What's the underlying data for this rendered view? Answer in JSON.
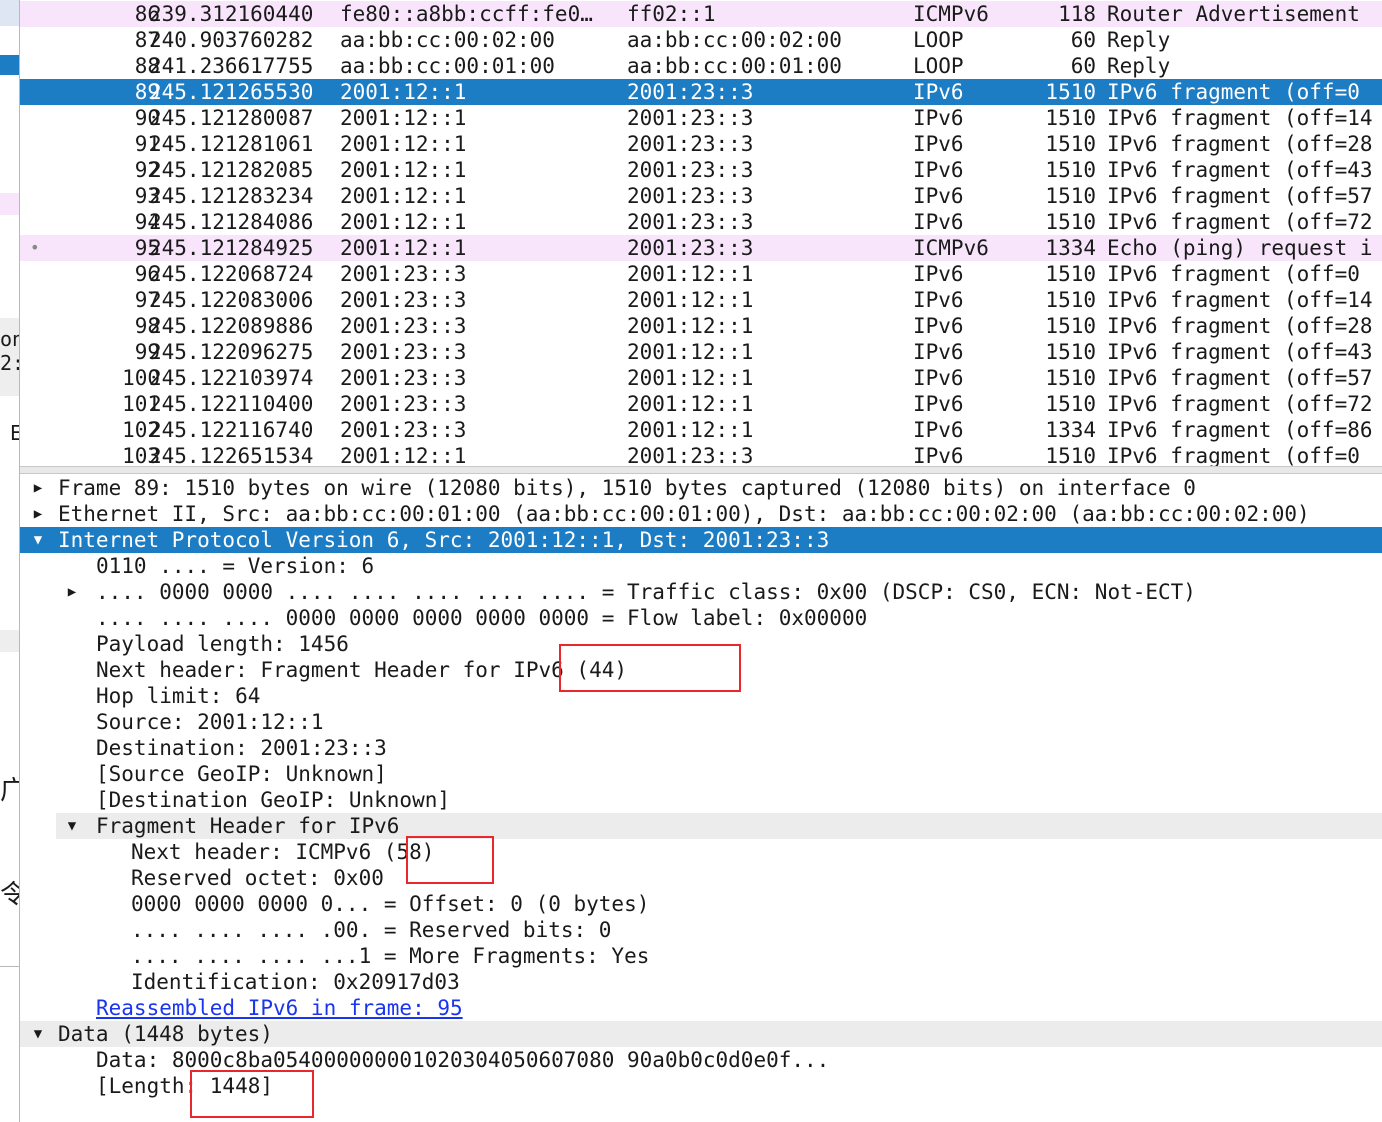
{
  "left_strip": {
    "fragments": [
      "on",
      "2:",
      "E",
      "广",
      "令"
    ]
  },
  "packets": [
    {
      "no": "86",
      "time": "239.312160440",
      "src": "fe80::a8bb:ccff:fe0…",
      "dst": "ff02::1",
      "proto": "ICMPv6",
      "len": "118",
      "info": "Router Advertisement",
      "style": "pink"
    },
    {
      "no": "87",
      "time": "240.903760282",
      "src": "aa:bb:cc:00:02:00",
      "dst": "aa:bb:cc:00:02:00",
      "proto": "LOOP",
      "len": "60",
      "info": "Reply",
      "style": ""
    },
    {
      "no": "88",
      "time": "241.236617755",
      "src": "aa:bb:cc:00:01:00",
      "dst": "aa:bb:cc:00:01:00",
      "proto": "LOOP",
      "len": "60",
      "info": "Reply",
      "style": ""
    },
    {
      "no": "89",
      "time": "245.121265530",
      "src": "2001:12::1",
      "dst": "2001:23::3",
      "proto": "IPv6",
      "len": "1510",
      "info": "IPv6 fragment (off=0",
      "style": "sel"
    },
    {
      "no": "90",
      "time": "245.121280087",
      "src": "2001:12::1",
      "dst": "2001:23::3",
      "proto": "IPv6",
      "len": "1510",
      "info": "IPv6 fragment (off=14",
      "style": ""
    },
    {
      "no": "91",
      "time": "245.121281061",
      "src": "2001:12::1",
      "dst": "2001:23::3",
      "proto": "IPv6",
      "len": "1510",
      "info": "IPv6 fragment (off=28",
      "style": ""
    },
    {
      "no": "92",
      "time": "245.121282085",
      "src": "2001:12::1",
      "dst": "2001:23::3",
      "proto": "IPv6",
      "len": "1510",
      "info": "IPv6 fragment (off=43",
      "style": ""
    },
    {
      "no": "93",
      "time": "245.121283234",
      "src": "2001:12::1",
      "dst": "2001:23::3",
      "proto": "IPv6",
      "len": "1510",
      "info": "IPv6 fragment (off=57",
      "style": ""
    },
    {
      "no": "94",
      "time": "245.121284086",
      "src": "2001:12::1",
      "dst": "2001:23::3",
      "proto": "IPv6",
      "len": "1510",
      "info": "IPv6 fragment (off=72",
      "style": ""
    },
    {
      "no": "95",
      "time": "245.121284925",
      "src": "2001:12::1",
      "dst": "2001:23::3",
      "proto": "ICMPv6",
      "len": "1334",
      "info": "Echo (ping) request i",
      "style": "pink",
      "mark": "•"
    },
    {
      "no": "96",
      "time": "245.122068724",
      "src": "2001:23::3",
      "dst": "2001:12::1",
      "proto": "IPv6",
      "len": "1510",
      "info": "IPv6 fragment (off=0",
      "style": ""
    },
    {
      "no": "97",
      "time": "245.122083006",
      "src": "2001:23::3",
      "dst": "2001:12::1",
      "proto": "IPv6",
      "len": "1510",
      "info": "IPv6 fragment (off=14",
      "style": ""
    },
    {
      "no": "98",
      "time": "245.122089886",
      "src": "2001:23::3",
      "dst": "2001:12::1",
      "proto": "IPv6",
      "len": "1510",
      "info": "IPv6 fragment (off=28",
      "style": ""
    },
    {
      "no": "99",
      "time": "245.122096275",
      "src": "2001:23::3",
      "dst": "2001:12::1",
      "proto": "IPv6",
      "len": "1510",
      "info": "IPv6 fragment (off=43",
      "style": ""
    },
    {
      "no": "100",
      "time": "245.122103974",
      "src": "2001:23::3",
      "dst": "2001:12::1",
      "proto": "IPv6",
      "len": "1510",
      "info": "IPv6 fragment (off=57",
      "style": ""
    },
    {
      "no": "101",
      "time": "245.122110400",
      "src": "2001:23::3",
      "dst": "2001:12::1",
      "proto": "IPv6",
      "len": "1510",
      "info": "IPv6 fragment (off=72",
      "style": ""
    },
    {
      "no": "102",
      "time": "245.122116740",
      "src": "2001:23::3",
      "dst": "2001:12::1",
      "proto": "IPv6",
      "len": "1334",
      "info": "IPv6 fragment (off=86",
      "style": ""
    },
    {
      "no": "103",
      "time": "245.122651534",
      "src": "2001:12::1",
      "dst": "2001:23::3",
      "proto": "IPv6",
      "len": "1510",
      "info": "IPv6 fragment (off=0",
      "style": ""
    }
  ],
  "details": [
    {
      "arrow": "▶",
      "text": "Frame 89: 1510 bytes on wire (12080 bits), 1510 bytes captured (12080 bits) on interface 0",
      "indent": 0,
      "style": ""
    },
    {
      "arrow": "▶",
      "text": "Ethernet II, Src: aa:bb:cc:00:01:00 (aa:bb:cc:00:01:00), Dst: aa:bb:cc:00:02:00 (aa:bb:cc:00:02:00)",
      "indent": 0,
      "style": ""
    },
    {
      "arrow": "▼",
      "text": "Internet Protocol Version 6, Src: 2001:12::1, Dst: 2001:23::3",
      "indent": 0,
      "style": "sel"
    },
    {
      "arrow": "",
      "text": "0110 .... = Version: 6",
      "indent": 1,
      "style": ""
    },
    {
      "arrow": "▶",
      "text": ".... 0000 0000 .... .... .... .... .... = Traffic class: 0x00 (DSCP: CS0, ECN: Not-ECT)",
      "indent": 1,
      "style": ""
    },
    {
      "arrow": "",
      "text": ".... .... .... 0000 0000 0000 0000 0000 = Flow label: 0x00000",
      "indent": 1,
      "style": ""
    },
    {
      "arrow": "",
      "text": "Payload length: 1456",
      "indent": 1,
      "style": ""
    },
    {
      "arrow": "",
      "text": "Next header: Fragment Header for IPv6 (44)",
      "indent": 1,
      "style": ""
    },
    {
      "arrow": "",
      "text": "Hop limit: 64",
      "indent": 1,
      "style": ""
    },
    {
      "arrow": "",
      "text": "Source: 2001:12::1",
      "indent": 1,
      "style": ""
    },
    {
      "arrow": "",
      "text": "Destination: 2001:23::3",
      "indent": 1,
      "style": ""
    },
    {
      "arrow": "",
      "text": "[Source GeoIP: Unknown]",
      "indent": 1,
      "style": ""
    },
    {
      "arrow": "",
      "text": "[Destination GeoIP: Unknown]",
      "indent": 1,
      "style": ""
    },
    {
      "arrow": "▼",
      "text": "Fragment Header for IPv6",
      "indent": 1,
      "style": "grey"
    },
    {
      "arrow": "",
      "text": "Next header: ICMPv6 (58)",
      "indent": 2,
      "style": ""
    },
    {
      "arrow": "",
      "text": "Reserved octet: 0x00",
      "indent": 2,
      "style": ""
    },
    {
      "arrow": "",
      "text": "0000 0000 0000 0... = Offset: 0 (0 bytes)",
      "indent": 2,
      "style": ""
    },
    {
      "arrow": "",
      "text": ".... .... .... .00. = Reserved bits: 0",
      "indent": 2,
      "style": ""
    },
    {
      "arrow": "",
      "text": ".... .... .... ...1 = More Fragments: Yes",
      "indent": 2,
      "style": ""
    },
    {
      "arrow": "",
      "text": "Identification: 0x20917d03",
      "indent": 2,
      "style": ""
    },
    {
      "arrow": "",
      "text": "Reassembled IPv6 in frame: 95",
      "indent": 1,
      "style": "link"
    },
    {
      "arrow": "▼",
      "text": "Data (1448 bytes)",
      "indent": 0,
      "style": "grey"
    },
    {
      "arrow": "",
      "text": "Data: 8000c8ba054000000001020304050607080 90a0b0c0d0e0f...",
      "indent": 1,
      "style": ""
    },
    {
      "arrow": "",
      "text": "[Length: 1448]",
      "indent": 1,
      "style": ""
    }
  ],
  "colors": {
    "selection": "#1c7cc4",
    "icmp_row": "#f8e5fb",
    "highlight_box": "#e8282b",
    "link": "#1a35ee"
  }
}
